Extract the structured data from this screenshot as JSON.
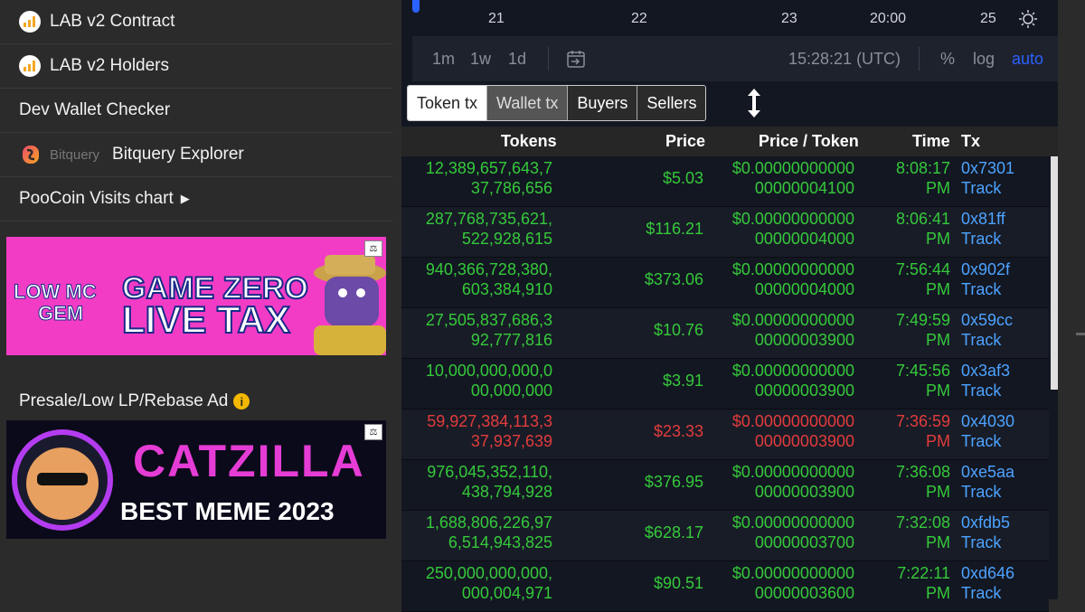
{
  "sidebar": {
    "items": [
      {
        "label": "LAB v2 Contract",
        "icon": "chart-bars-icon"
      },
      {
        "label": "LAB v2 Holders",
        "icon": "chart-bars-icon"
      },
      {
        "label": "Dev Wallet Checker"
      },
      {
        "label": "Bitquery Explorer",
        "brand": "Bitquery",
        "icon": "bitquery-logo-icon"
      },
      {
        "label": "PooCoin Visits chart",
        "icon": "caret-right-icon"
      }
    ],
    "ad1_text": "LOW MC GEM GAME ZERO LIVE TAX",
    "presale_label": "Presale/Low LP/Rebase Ad",
    "ad2_text": "CATZILLA BEST MEME 2023"
  },
  "chart": {
    "x_ticks": [
      "21",
      "22",
      "23",
      "20:00",
      "25"
    ],
    "ranges": [
      "1m",
      "1w",
      "1d"
    ],
    "clock": "15:28:21 (UTC)",
    "scale_options": [
      "%",
      "log",
      "auto"
    ]
  },
  "tabs": [
    "Token tx",
    "Wallet tx",
    "Buyers",
    "Sellers"
  ],
  "table": {
    "headers": [
      "Tokens",
      "Price",
      "Price / Token",
      "Time",
      "Tx"
    ],
    "rows": [
      {
        "tokens": "12,389,657,643,737,786,656",
        "price": "$5.03",
        "price_token": "$0.0000000000000000004100",
        "time": "8:08:17 PM",
        "tx": "0x7301",
        "track": "Track",
        "side": "buy"
      },
      {
        "tokens": "287,768,735,621,522,928,615",
        "price": "$116.21",
        "price_token": "$0.0000000000000000004000",
        "time": "8:06:41 PM",
        "tx": "0x81ff",
        "track": "Track",
        "side": "buy"
      },
      {
        "tokens": "940,366,728,380,603,384,910",
        "price": "$373.06",
        "price_token": "$0.0000000000000000004000",
        "time": "7:56:44 PM",
        "tx": "0x902f",
        "track": "Track",
        "side": "buy"
      },
      {
        "tokens": "27,505,837,686,392,777,816",
        "price": "$10.76",
        "price_token": "$0.0000000000000000003900",
        "time": "7:49:59 PM",
        "tx": "0x59cc",
        "track": "Track",
        "side": "buy"
      },
      {
        "tokens": "10,000,000,000,000,000,000",
        "price": "$3.91",
        "price_token": "$0.0000000000000000003900",
        "time": "7:45:56 PM",
        "tx": "0x3af3",
        "track": "Track",
        "side": "buy"
      },
      {
        "tokens": "59,927,384,113,337,937,639",
        "price": "$23.33",
        "price_token": "$0.0000000000000000003900",
        "time": "7:36:59 PM",
        "tx": "0x4030",
        "track": "Track",
        "side": "sell"
      },
      {
        "tokens": "976,045,352,110,438,794,928",
        "price": "$376.95",
        "price_token": "$0.0000000000000000003900",
        "time": "7:36:08 PM",
        "tx": "0xe5aa",
        "track": "Track",
        "side": "buy"
      },
      {
        "tokens": "1,688,806,226,976,514,943,825",
        "price": "$628.17",
        "price_token": "$0.0000000000000000003700",
        "time": "7:32:08 PM",
        "tx": "0xfdb5",
        "track": "Track",
        "side": "buy"
      },
      {
        "tokens": "250,000,000,000,000,004,971",
        "price": "$90.51",
        "price_token": "$0.0000000000000000003600",
        "time": "7:22:11 PM",
        "tx": "0xd646",
        "track": "Track",
        "side": "buy"
      }
    ]
  },
  "colors": {
    "buy": "#35c93a",
    "sell": "#e23c3c",
    "link": "#4da3ff",
    "auto": "#2962ff"
  }
}
